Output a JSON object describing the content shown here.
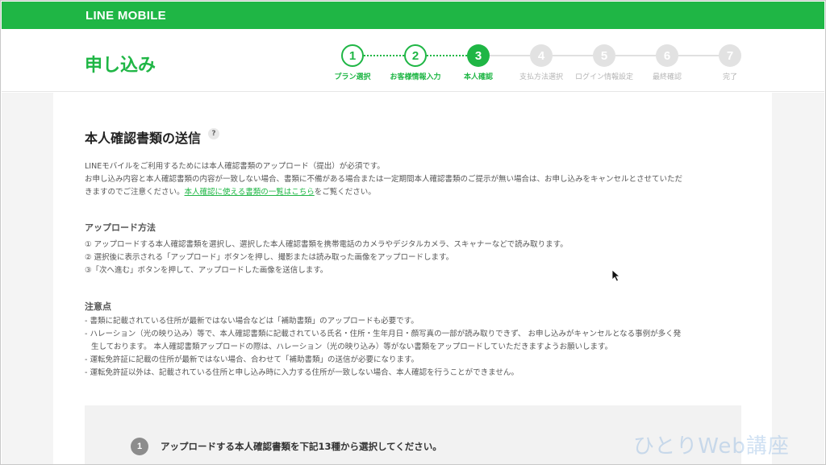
{
  "brand": "LINE MOBILE",
  "page_title": "申し込み",
  "steps": [
    {
      "num": "1",
      "label": "プラン選択",
      "state": "done"
    },
    {
      "num": "2",
      "label": "お客様情報入力",
      "state": "done"
    },
    {
      "num": "3",
      "label": "本人確認",
      "state": "active"
    },
    {
      "num": "4",
      "label": "支払方法選択",
      "state": "todo"
    },
    {
      "num": "5",
      "label": "ログイン情報設定",
      "state": "todo"
    },
    {
      "num": "6",
      "label": "最終確認",
      "state": "todo"
    },
    {
      "num": "7",
      "label": "完了",
      "state": "todo"
    }
  ],
  "section": {
    "title": "本人確認書類の送信",
    "help": "?",
    "intro_1": "LINEモバイルをご利用するためには本人確認書類のアップロード（提出）が必須です。",
    "intro_2": "お申し込み内容と本人確認書類の内容が一致しない場合、書類に不備がある場合または一定期間本人確認書類のご提示が無い場合は、お申し込みをキャンセルとさせていただ",
    "intro_3_pre": "きますのでご注意ください。",
    "intro_3_link": "本人確認に使える書類の一覧はこちら",
    "intro_3_post": "をご覧ください。"
  },
  "upload_method": {
    "title": "アップロード方法",
    "items": [
      "① アップロードする本人確認書類を選択し、選択した本人確認書類を携帯電話のカメラやデジタルカメラ、スキャナーなどで読み取ります。",
      "② 選択後に表示される「アップロード」ボタンを押し、撮影または読み取った画像をアップロードします。",
      "③「次へ進む」ボタンを押して、アップロードした画像を送信します。"
    ]
  },
  "notes": {
    "title": "注意点",
    "items": [
      "- 書類に記載されている住所が最新ではない場合などは「補助書類」のアップロードも必要です。",
      "- ハレーション（光の映り込み）等で、本人確認書類に記載されている氏名・住所・生年月日・顔写真の一部が読み取りできず、 お申し込みがキャンセルとなる事例が多く発",
      "生しております。 本人確認書類アップロードの際は、ハレーション（光の映り込み）等がない書類をアップロードしていただきますようお願いします。",
      "- 運転免許証に記載の住所が最新ではない場合、合わせて「補助書類」の送信が必要になります。",
      "- 運転免許証以外は、記載されている住所と申し込み時に入力する住所が一致しない場合、本人確認を行うことができません。"
    ]
  },
  "select_step": {
    "num": "1",
    "text": "アップロードする本人確認書類を下記13種から選択してください。"
  },
  "watermark": "ひとりWeb講座",
  "colors": {
    "accent": "#1fb645",
    "inactive": "#e2e2e2",
    "background": "#f4f4f4"
  }
}
